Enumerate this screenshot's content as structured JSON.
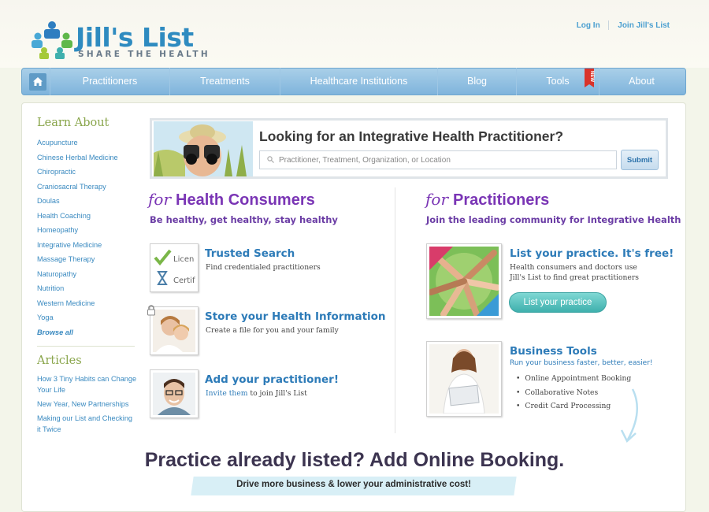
{
  "brand": {
    "name": "Jill's List",
    "tagline": "SHARE THE HEALTH"
  },
  "top_links": {
    "login": "Log In",
    "join": "Join Jill's List"
  },
  "nav": {
    "items": [
      {
        "label": "Practitioners"
      },
      {
        "label": "Treatments"
      },
      {
        "label": "Healthcare Institutions"
      },
      {
        "label": "Blog"
      },
      {
        "label": "Tools",
        "badge": "NEW"
      },
      {
        "label": "About"
      }
    ]
  },
  "sidebar": {
    "learn_title": "Learn About",
    "learn_items": [
      "Acupuncture",
      "Chinese Herbal Medicine",
      "Chiropractic",
      "Craniosacral Therapy",
      "Doulas",
      "Health Coaching",
      "Homeopathy",
      "Integrative Medicine",
      "Massage Therapy",
      "Naturopathy",
      "Nutrition",
      "Western Medicine",
      "Yoga"
    ],
    "browse_all": "Browse all",
    "articles_title": "Articles",
    "articles": [
      "How 3 Tiny Habits can Change Your Life",
      "New Year, New Partnerships",
      "Making our List and Checking it Twice"
    ]
  },
  "search": {
    "title": "Looking for an Integrative Health Practitioner?",
    "placeholder": "Practitioner, Treatment, Organization, or Location",
    "submit": "Submit"
  },
  "consumers": {
    "for": "for",
    "title": "Health Consumers",
    "subtitle": "Be healthy, get healthy, stay healthy",
    "items": [
      {
        "title": "Trusted Search",
        "desc": "Find credentialed practitioners",
        "thumb_words": [
          "Licen",
          "Certif"
        ]
      },
      {
        "title": "Store your Health Information",
        "desc": "Create a file for you and your family"
      },
      {
        "title": "Add your practitioner!",
        "desc_link": "Invite them",
        "desc_rest": " to join Jill's List"
      }
    ]
  },
  "practitioners": {
    "for": "for",
    "title": "Practitioners",
    "subtitle": "Join the leading community for Integrative Health",
    "list_title": "List your practice. It's free!",
    "list_desc": "Health consumers and doctors use Jill's List to find great practitioners",
    "list_button": "List your practice",
    "tools_title": "Business Tools",
    "tools_sub": "Run your business faster, better, easier!",
    "tools_list": [
      "Online Appointment Booking",
      "Collaborative Notes",
      "Credit Card Processing"
    ]
  },
  "promo": {
    "title": "Practice already listed? Add Online Booking.",
    "subtitle": "Drive more business & lower your administrative cost!"
  },
  "colors": {
    "nav_blue": "#7fb4dc",
    "purple": "#7a35b5",
    "green": "#8aa64c",
    "link_blue": "#2d7bb8"
  }
}
